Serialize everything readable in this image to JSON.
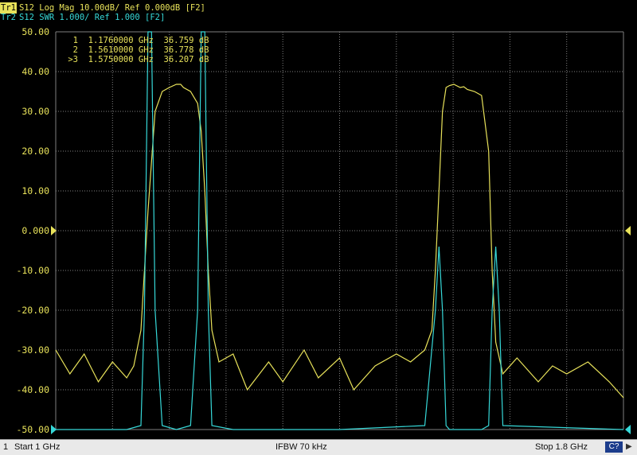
{
  "header": {
    "trace1_badge": "Tr1",
    "trace1_text": "S12 Log Mag 10.00dB/ Ref 0.000dB [F2]",
    "trace2_badge": "Tr2",
    "trace2_text": "S12 SWR 1.000/ Ref 1.000 [F2]"
  },
  "y_axis_labels": [
    "50.00",
    "40.00",
    "30.00",
    "20.00",
    "10.00",
    "0.000",
    "-10.00",
    "-20.00",
    "-30.00",
    "-40.00",
    "-50.00"
  ],
  "markers": [
    {
      "id": "1",
      "freq": "1.1760000 GHz",
      "value": "36.759 dB"
    },
    {
      "id": "2",
      "freq": "1.5610000 GHz",
      "value": "36.778 dB"
    },
    {
      "id": ">3",
      "freq": "1.5750000 GHz",
      "value": "36.207 dB"
    }
  ],
  "status_bar": {
    "channel": "1",
    "start": "Start 1 GHz",
    "ifbw": "IFBW 70 kHz",
    "stop": "Stop 1.8 GHz",
    "indicator": "C?"
  },
  "colors": {
    "trace1": "#e8e25a",
    "trace2": "#36d8d8",
    "grid": "#7f7f7f",
    "background": "#000000"
  },
  "chart_data": {
    "type": "line",
    "x_range_ghz": [
      1.0,
      1.8
    ],
    "ylim": [
      -50,
      50
    ],
    "series": [
      {
        "name": "Tr1 S12 Log Mag",
        "x": [
          1.0,
          1.02,
          1.04,
          1.06,
          1.08,
          1.1,
          1.11,
          1.12,
          1.125,
          1.13,
          1.14,
          1.15,
          1.16,
          1.17,
          1.176,
          1.18,
          1.19,
          1.2,
          1.205,
          1.21,
          1.215,
          1.22,
          1.23,
          1.25,
          1.27,
          1.3,
          1.32,
          1.35,
          1.37,
          1.4,
          1.42,
          1.45,
          1.48,
          1.5,
          1.52,
          1.53,
          1.535,
          1.54,
          1.545,
          1.55,
          1.555,
          1.561,
          1.57,
          1.575,
          1.58,
          1.59,
          1.6,
          1.61,
          1.615,
          1.62,
          1.63,
          1.65,
          1.68,
          1.7,
          1.72,
          1.75,
          1.78,
          1.8
        ],
        "y": [
          -30,
          -36,
          -31,
          -38,
          -33,
          -37,
          -34,
          -25,
          -10,
          5,
          30,
          35,
          36,
          36.8,
          36.8,
          36,
          35,
          32,
          25,
          10,
          -10,
          -25,
          -33,
          -31,
          -40,
          -33,
          -38,
          -30,
          -37,
          -32,
          -40,
          -34,
          -31,
          -33,
          -30,
          -25,
          -10,
          10,
          30,
          36,
          36.5,
          36.8,
          36,
          36.2,
          35.5,
          35,
          34,
          20,
          -10,
          -28,
          -36,
          -32,
          -38,
          -34,
          -36,
          -33,
          -38,
          -42
        ]
      },
      {
        "name": "Tr2 S12 SWR",
        "x": [
          1.0,
          1.1,
          1.12,
          1.125,
          1.13,
          1.135,
          1.14,
          1.15,
          1.17,
          1.19,
          1.2,
          1.205,
          1.21,
          1.215,
          1.22,
          1.25,
          1.4,
          1.52,
          1.535,
          1.54,
          1.545,
          1.55,
          1.555,
          1.6,
          1.61,
          1.615,
          1.62,
          1.625,
          1.63,
          1.8
        ],
        "y": [
          -50,
          -50,
          -49,
          -20,
          50,
          50,
          -20,
          -49,
          -50,
          -49,
          -20,
          50,
          50,
          -20,
          -49,
          -50,
          -50,
          -49,
          -20,
          -4,
          -20,
          -49,
          -50,
          -50,
          -49,
          -20,
          -4,
          -20,
          -49,
          -50
        ]
      }
    ],
    "grid": true
  }
}
